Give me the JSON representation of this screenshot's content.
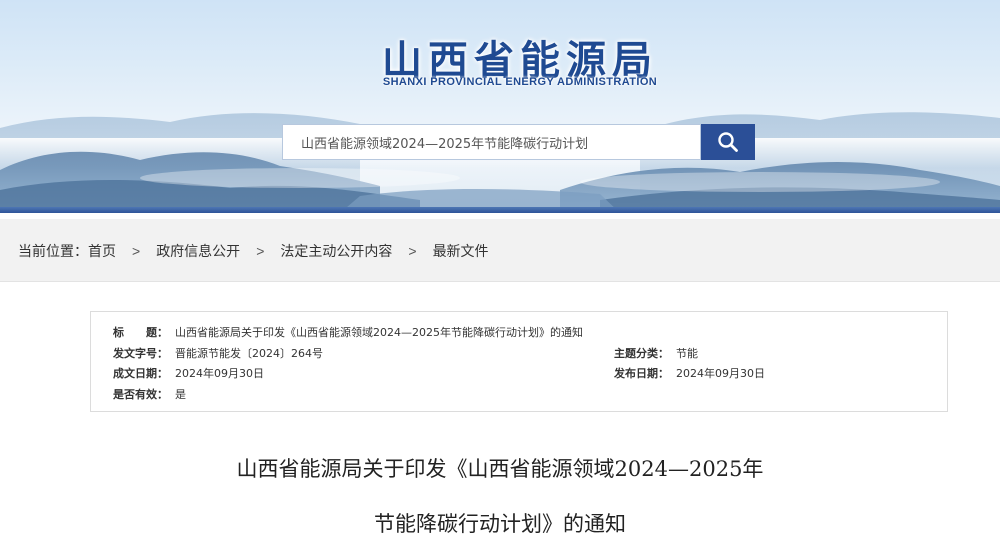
{
  "header": {
    "title_cn": "山西省能源局",
    "title_en": "SHANXI  PROVINCIAL  ENERGY ADMINISTRATION"
  },
  "search": {
    "value": "山西省能源领域2024—2025年节能降碳行动计划",
    "button_icon": "search-icon"
  },
  "breadcrumb": {
    "prefix": "当前位置：",
    "items": [
      "首页",
      "政府信息公开",
      "法定主动公开内容",
      "最新文件"
    ],
    "separator": ">"
  },
  "meta": {
    "title_label": "标　　题：",
    "title_value": "山西省能源局关于印发《山西省能源领域2024—2025年节能降碳行动计划》的通知",
    "doc_no_label": "发文字号：",
    "doc_no_value": "晋能源节能发〔2024〕264号",
    "category_label": "主题分类：",
    "category_value": "节能",
    "created_label": "成文日期：",
    "created_value": "2024年09月30日",
    "published_label": "发布日期：",
    "published_value": "2024年09月30日",
    "valid_label": "是否有效：",
    "valid_value": "是"
  },
  "document": {
    "title_line1": "山西省能源局关于印发《山西省能源领域2024—2025年",
    "title_line2": "节能降碳行动计划》的通知"
  },
  "colors": {
    "brand_blue": "#1f4a92",
    "search_button": "#2b4f97",
    "breadcrumb_bg": "#f2f2f2"
  }
}
